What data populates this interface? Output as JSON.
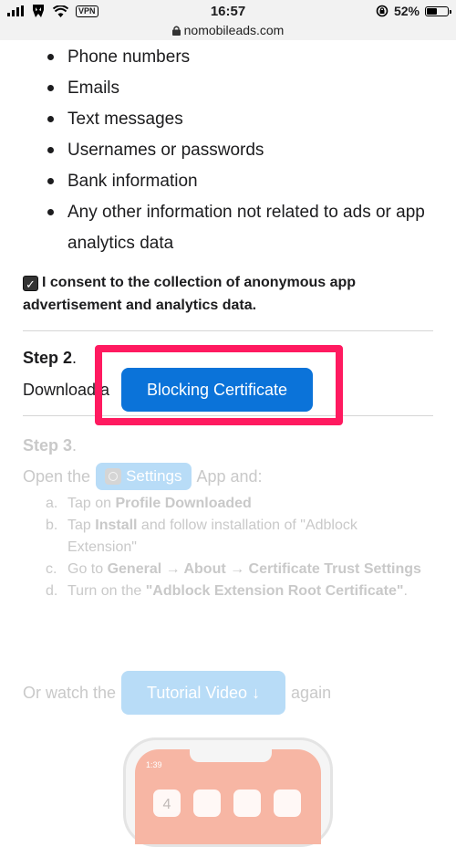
{
  "status_bar": {
    "time": "16:57",
    "vpn_label": "VPN",
    "battery_percent": 52,
    "battery_label": "52%"
  },
  "url_bar": {
    "domain": "nomobileads.com"
  },
  "data_types": [
    "Phone numbers",
    "Emails",
    "Text messages",
    "Usernames or passwords",
    "Bank information",
    "Any other information not related to ads or app analytics data"
  ],
  "consent": {
    "checked": true,
    "text": "I consent to the collection of anonymous app advertisement and analytics data."
  },
  "step2": {
    "title": "Step 2",
    "text": "Download a",
    "button_label": "Blocking Certificate",
    "highlight_color": "#ff1a60"
  },
  "step3": {
    "title": "Step 3",
    "open_text": "Open the",
    "settings_label": "Settings",
    "app_text": "App and:",
    "items": [
      {
        "letter": "a.",
        "parts": [
          "Tap on ",
          "Profile Downloaded",
          ""
        ]
      },
      {
        "letter": "b.",
        "parts": [
          "Tap ",
          "Install",
          " and follow installation of \"Adblock Extension\""
        ]
      },
      {
        "letter": "c.",
        "parts": [
          "Go to ",
          "General → About → Certificate Trust Settings",
          ""
        ]
      },
      {
        "letter": "d.",
        "parts": [
          "Turn on the ",
          "\"Adblock Extension Root Certificate\"",
          "."
        ]
      }
    ]
  },
  "watch": {
    "prefix": "Or watch the",
    "button_label": "Tutorial Video ↓",
    "suffix": "again"
  },
  "phone_preview": {
    "time": "1:39",
    "calendar_day": "4"
  },
  "colors": {
    "primary": "#0b73d9",
    "faded_button": "#b8dcf7",
    "faded_text": "#c9c9c9"
  }
}
